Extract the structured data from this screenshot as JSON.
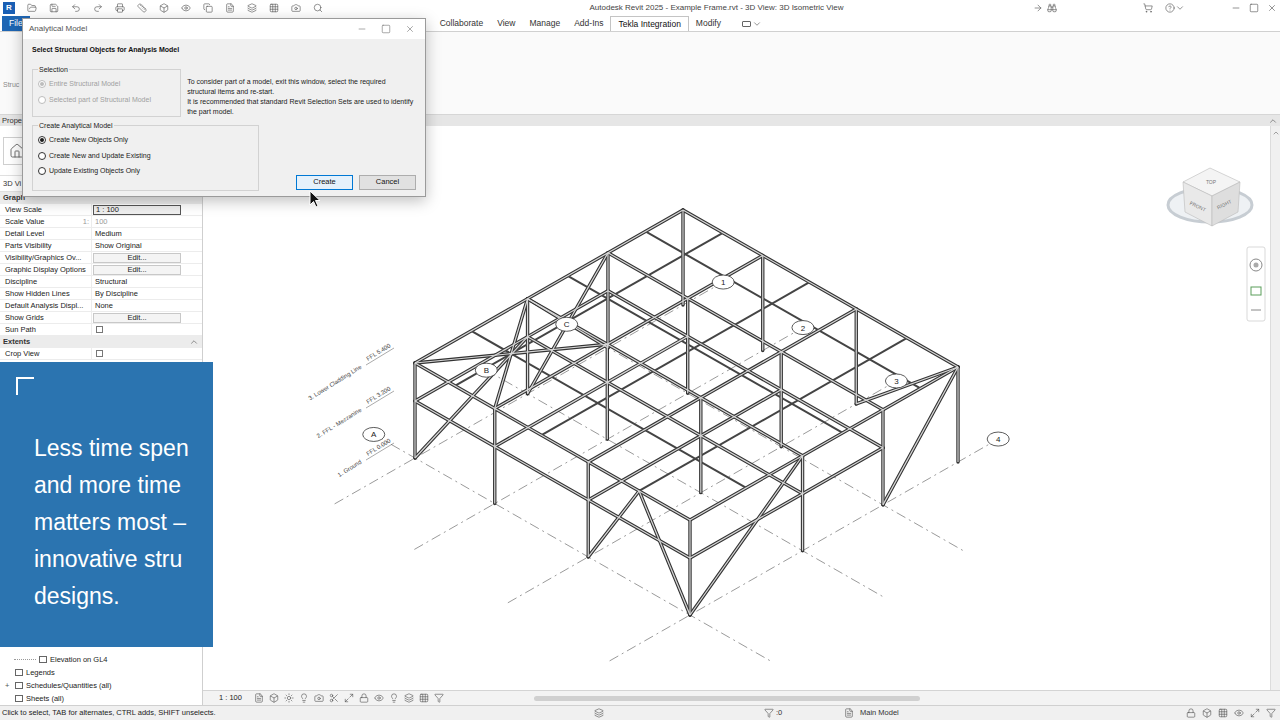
{
  "window": {
    "title": "Autodesk Revit 2025 - Example Frame.rvt - 3D View: 3D Isometric View"
  },
  "app_logo": "R",
  "ribbon": {
    "tabs": [
      {
        "label": "File",
        "selected": false,
        "kind": "file"
      },
      {
        "label": "Collaborate",
        "selected": false,
        "kind": "tab"
      },
      {
        "label": "View",
        "selected": false,
        "kind": "tab"
      },
      {
        "label": "Manage",
        "selected": false,
        "kind": "tab"
      },
      {
        "label": "Add-Ins",
        "selected": false,
        "kind": "tab"
      },
      {
        "label": "Tekla Integration",
        "selected": true,
        "kind": "tab"
      },
      {
        "label": "Modify",
        "selected": false,
        "kind": "tab"
      }
    ],
    "panel_text": "Struc"
  },
  "properties": {
    "title": "Prope",
    "view_type": "3D Vi",
    "group": "Graph",
    "rows": [
      {
        "label": "View Scale",
        "value": "1 : 100",
        "kind": "field"
      },
      {
        "label": "Scale Value",
        "prefix": "1:",
        "value": "100",
        "kind": "disabled"
      },
      {
        "label": "Detail Level",
        "value": "Medium",
        "kind": "text"
      },
      {
        "label": "Parts Visibility",
        "value": "Show Original",
        "kind": "text"
      },
      {
        "label": "Visibility/Graphics Ov...",
        "value": "Edit...",
        "kind": "button"
      },
      {
        "label": "Graphic Display Options",
        "value": "Edit...",
        "kind": "button"
      },
      {
        "label": "Discipline",
        "value": "Structural",
        "kind": "text"
      },
      {
        "label": "Show Hidden Lines",
        "value": "By Discipline",
        "kind": "text"
      },
      {
        "label": "Default Analysis Displ...",
        "value": "None",
        "kind": "text"
      },
      {
        "label": "Show Grids",
        "value": "Edit...",
        "kind": "button"
      },
      {
        "label": "Sun Path",
        "kind": "checkbox",
        "checked": false
      },
      {
        "label": "Extents",
        "kind": "section",
        "expanded": true
      },
      {
        "label": "Crop View",
        "kind": "checkbox",
        "checked": false
      }
    ]
  },
  "project_browser": [
    {
      "label": "Elevation on GL4",
      "kind": "view"
    },
    {
      "label": "Legends",
      "kind": "category"
    },
    {
      "label": "Schedules/Quantities (all)",
      "kind": "category",
      "expander": "+"
    },
    {
      "label": "Sheets (all)",
      "kind": "category"
    }
  ],
  "banner": {
    "lines": [
      "Less time spen",
      "and more time",
      "matters most –",
      "innovative stru",
      "designs."
    ]
  },
  "dialog": {
    "title": "Analytical Model",
    "heading": "Select Structural Objects for Analysis Model",
    "selection": {
      "label": "Selection",
      "options": [
        {
          "label": "Entire Structural Model",
          "selected": true,
          "disabled": true
        },
        {
          "label": "Selected part of Structural Model",
          "selected": false,
          "disabled": true
        }
      ]
    },
    "note": [
      "To consider part of a model, exit this window, select the required structural items and re-start.",
      "It is recommended that standard Revit Selection Sets are used to identify the part model."
    ],
    "create": {
      "label": "Create Analytical Model",
      "options": [
        {
          "label": "Create New Objects Only",
          "selected": true
        },
        {
          "label": "Create New and Update Existing",
          "selected": false
        },
        {
          "label": "Update Existing Objects Only",
          "selected": false
        }
      ]
    },
    "buttons": [
      {
        "label": "Create",
        "focused": true
      },
      {
        "label": "Cancel",
        "focused": false
      }
    ]
  },
  "drawing": {
    "level_tags": [
      {
        "elevation": "FFL 5.400",
        "name": "3. Lower Cladding Line"
      },
      {
        "elevation": "FFL 3.200",
        "name": "2. FFL - Mezzanine"
      },
      {
        "elevation": "FFL 0.000",
        "name": "1. Ground"
      }
    ],
    "letter_grids": [
      {
        "label": "A"
      },
      {
        "label": "B"
      },
      {
        "label": "C"
      }
    ],
    "number_grids": [
      {
        "label": "1"
      },
      {
        "label": "2"
      },
      {
        "label": "3"
      },
      {
        "label": "4"
      }
    ]
  },
  "view_cube": {
    "faces": [
      "TOP",
      "FRONT",
      "RIGHT"
    ]
  },
  "view_control": {
    "scale": "1 : 100"
  },
  "status_bar": {
    "message": "Click to select, TAB for alternates, CTRL adds, SHIFT unselects.",
    "selection_count": ":0",
    "workset": "Main Model"
  }
}
